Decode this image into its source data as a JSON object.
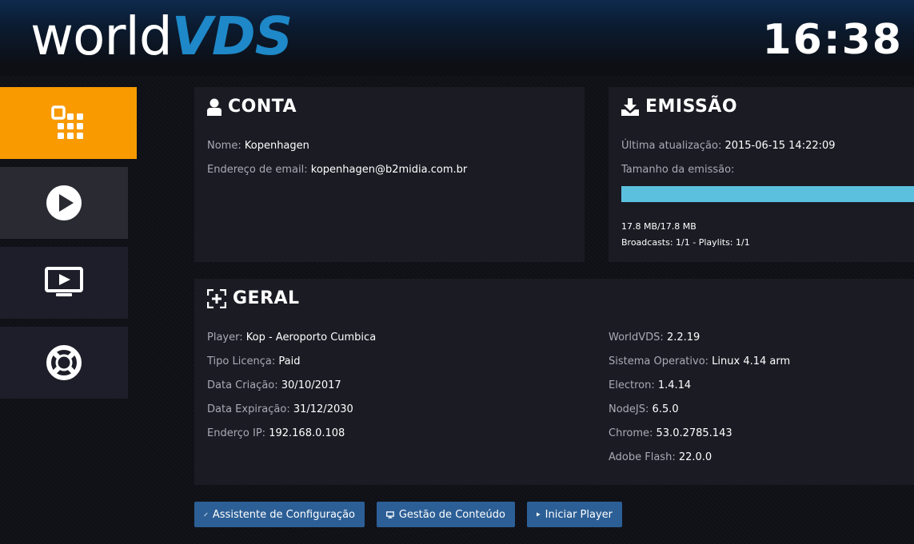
{
  "header": {
    "logo_part1": "world",
    "logo_part2": "VDS",
    "clock": "16:38"
  },
  "sidebar": {
    "items": [
      {
        "name": "dashboard",
        "icon": "apps-grid-icon",
        "active": true
      },
      {
        "name": "play",
        "icon": "play-circle-icon",
        "active": false
      },
      {
        "name": "monitor",
        "icon": "tv-play-icon",
        "active": false
      },
      {
        "name": "support",
        "icon": "lifebuoy-icon",
        "active": false
      }
    ]
  },
  "conta": {
    "title": "CONTA",
    "icon": "user-icon",
    "nome_label": "Nome:",
    "nome_value": "Kopenhagen",
    "email_label": "Endereço de email:",
    "email_value": "kopenhagen@b2midia.com.br"
  },
  "emissao": {
    "title": "EMISSÃO",
    "icon": "download-icon",
    "update_label": "Última atualização:",
    "update_value": "2015-06-15 14:22:09",
    "size_label": "Tamanho da emissão:",
    "progress_percent": 100,
    "size_text": "17.8 MB/17.8 MB",
    "broadcasts_text": "Broadcasts: 1/1 - Playlits: 1/1"
  },
  "geral": {
    "title": "GERAL",
    "icon": "expand-plus-icon",
    "left": [
      {
        "label": "Player:",
        "value": "Kop - Aeroporto Cumbica"
      },
      {
        "label": "Tipo Licença:",
        "value": "Paid"
      },
      {
        "label": "Data Criação:",
        "value": "30/10/2017"
      },
      {
        "label": "Data Expiração:",
        "value": "31/12/2030"
      },
      {
        "label": "Enderço IP:",
        "value": "192.168.0.108"
      }
    ],
    "right": [
      {
        "label": "WorldVDS:",
        "value": "2.2.19"
      },
      {
        "label": "Sistema Operativo:",
        "value": "Linux 4.14 arm"
      },
      {
        "label": "Electron:",
        "value": "1.4.14"
      },
      {
        "label": "NodeJS:",
        "value": "6.5.0"
      },
      {
        "label": "Chrome:",
        "value": "53.0.2785.143"
      },
      {
        "label": "Adobe Flash:",
        "value": "22.0.0"
      }
    ]
  },
  "buttons": {
    "assistente": "Assistente de Configuração",
    "gestao": "Gestão de Conteúdo",
    "iniciar": "Iniciar Player"
  },
  "colors": {
    "accent": "#f89a00",
    "progress": "#5bc0de",
    "button": "#2c5f96",
    "logo_blue": "#1e88c8"
  }
}
